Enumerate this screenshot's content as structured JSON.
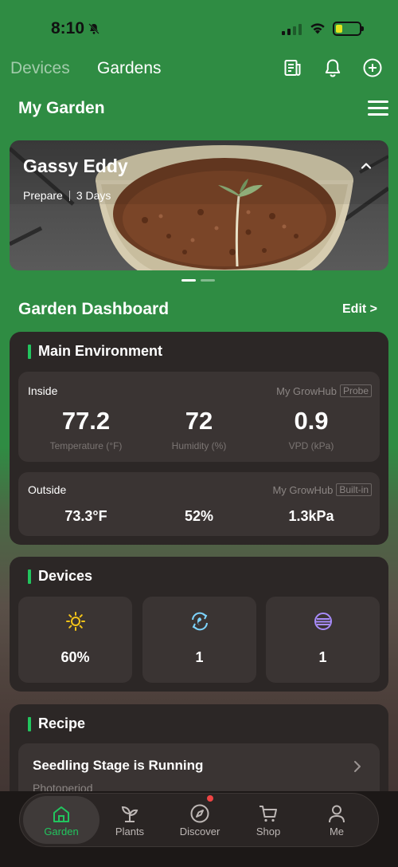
{
  "status_bar": {
    "time": "8:10"
  },
  "header": {
    "tabs": [
      "Devices",
      "Gardens"
    ],
    "active_tab": "Gardens"
  },
  "page": {
    "title": "My Garden"
  },
  "banner": {
    "name": "Gassy Eddy",
    "stage": "Prepare",
    "duration": "3 Days"
  },
  "dashboard": {
    "title": "Garden Dashboard",
    "edit_label": "Edit >"
  },
  "environment": {
    "title": "Main Environment",
    "inside": {
      "label": "Inside",
      "source": "My GrowHub",
      "source_tag": "Probe",
      "metrics": [
        {
          "value": "77.2",
          "unit": "Temperature (°F)"
        },
        {
          "value": "72",
          "unit": "Humidity (%)"
        },
        {
          "value": "0.9",
          "unit": "VPD (kPa)"
        }
      ]
    },
    "outside": {
      "label": "Outside",
      "source": "My GrowHub",
      "source_tag": "Built-in",
      "values": [
        "73.3°F",
        "52%",
        "1.3kPa"
      ]
    }
  },
  "devices": {
    "title": "Devices",
    "tiles": [
      {
        "icon": "sun-icon",
        "value": "60%",
        "color": "#f5c518"
      },
      {
        "icon": "fan-cycle-icon",
        "value": "1",
        "color": "#7dd3fc"
      },
      {
        "icon": "filter-icon",
        "value": "1",
        "color": "#a78bfa"
      }
    ]
  },
  "recipe": {
    "title": "Recipe",
    "row_title": "Seedling Stage is Running",
    "row_sub": "Photoperiod"
  },
  "nav": {
    "items": [
      {
        "label": "Garden",
        "icon": "home-icon"
      },
      {
        "label": "Plants",
        "icon": "sprout-icon"
      },
      {
        "label": "Discover",
        "icon": "compass-icon"
      },
      {
        "label": "Shop",
        "icon": "cart-icon"
      },
      {
        "label": "Me",
        "icon": "person-icon"
      }
    ],
    "active": "Garden"
  },
  "colors": {
    "accent_green": "#22c55e",
    "header_green": "#2f8c43",
    "card_bg": "#2c2726"
  }
}
